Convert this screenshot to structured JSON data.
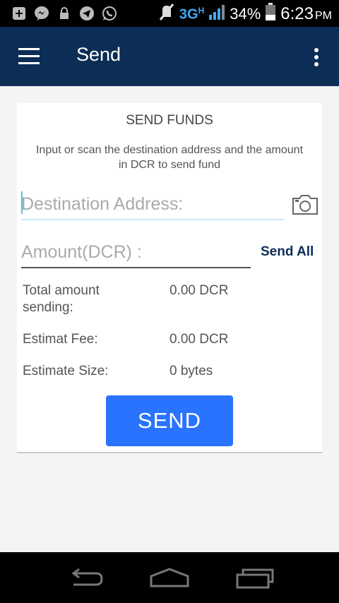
{
  "status_bar": {
    "network": "3G",
    "network_sub": "H",
    "battery": "34%",
    "time": "6:23",
    "ampm": "PM",
    "icons": [
      "plus-box-icon",
      "messenger-icon",
      "lock-icon",
      "telegram-icon",
      "whatsapp-icon",
      "mute-icon",
      "signal-icon",
      "battery-icon"
    ]
  },
  "app_bar": {
    "title": "Send",
    "menu_icon": "hamburger-menu-icon",
    "overflow_icon": "more-vert-icon"
  },
  "card": {
    "title": "SEND FUNDS",
    "description": "Input or scan the destination address and the amount in DCR to send fund",
    "destination": {
      "placeholder": "Destination Address:",
      "value": ""
    },
    "camera_icon": "camera-icon",
    "amount": {
      "placeholder": "Amount(DCR) :",
      "value": ""
    },
    "send_all_label": "Send All",
    "rows": [
      {
        "label": "Total amount sending:",
        "value": "0.00 DCR"
      },
      {
        "label": "Estimat Fee:",
        "value": "0.00 DCR"
      },
      {
        "label": "Estimate Size:",
        "value": "0 bytes"
      }
    ],
    "send_label": "SEND"
  },
  "nav_bar": {
    "icons": [
      "back-icon",
      "home-icon",
      "recents-icon"
    ]
  },
  "colors": {
    "app_bar": "#0c2d55",
    "send_button": "#2a73ff",
    "send_all_text": "#0c2d55",
    "network": "#3fa9f5"
  }
}
